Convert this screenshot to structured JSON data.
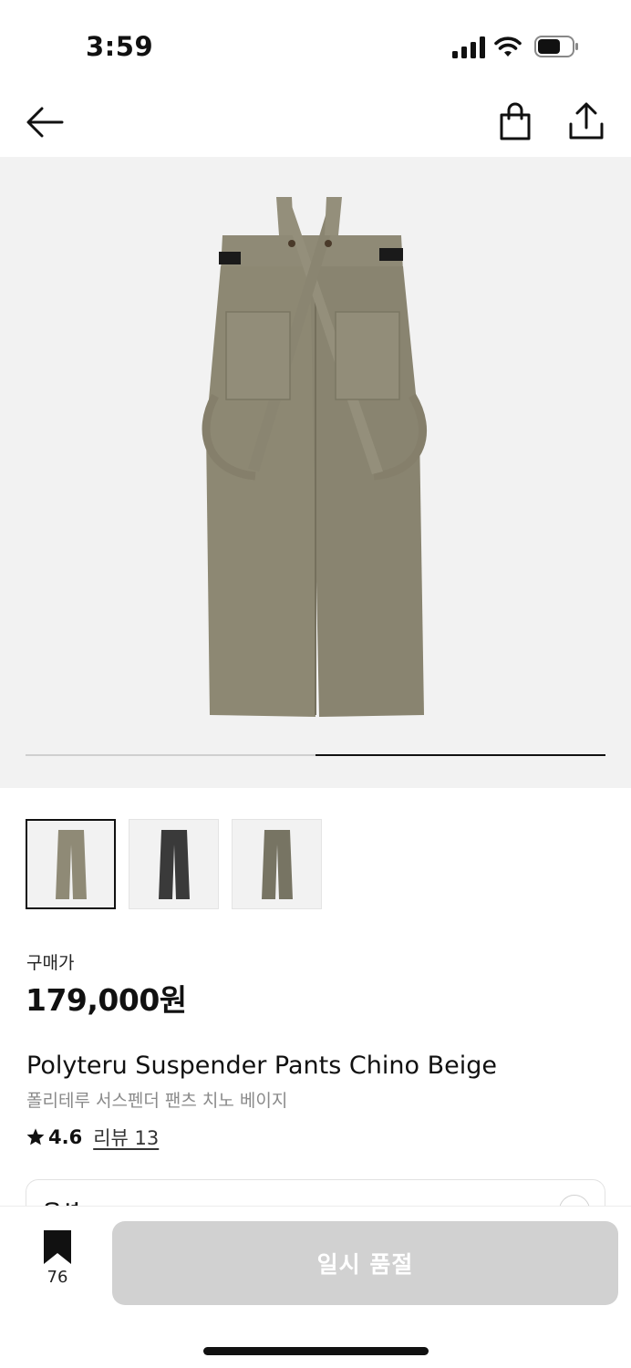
{
  "status_bar": {
    "time": "3:59",
    "icons": [
      "signal-icon",
      "wifi-icon",
      "battery-icon"
    ]
  },
  "nav": {
    "icons": [
      "back-arrow-icon",
      "shopping-bag-icon",
      "share-icon"
    ]
  },
  "gallery": {
    "image": "suspender-pants-back-view",
    "progress": 0.5,
    "thumbnails": [
      {
        "color": "#8f8a76",
        "selected": true
      },
      {
        "color": "#3a3a3a",
        "selected": false
      },
      {
        "color": "#777463",
        "selected": false
      }
    ]
  },
  "price": {
    "label": "구매가",
    "value": "179,000원"
  },
  "product": {
    "name": "Polyteru Suspender Pants Chino Beige",
    "name_ko": "폴리테루 서스펜더 팬츠 치노 베이지",
    "rating": "4.6",
    "review_link": "리뷰 13"
  },
  "options": {
    "label": "옵션"
  },
  "bottom_bar": {
    "bookmark_count": "76",
    "soldout_label": "일시 품절"
  },
  "colors": {
    "pants": "#8f8a76",
    "button_disabled": "#d1d1d1",
    "background_gallery": "#f2f2f2"
  }
}
